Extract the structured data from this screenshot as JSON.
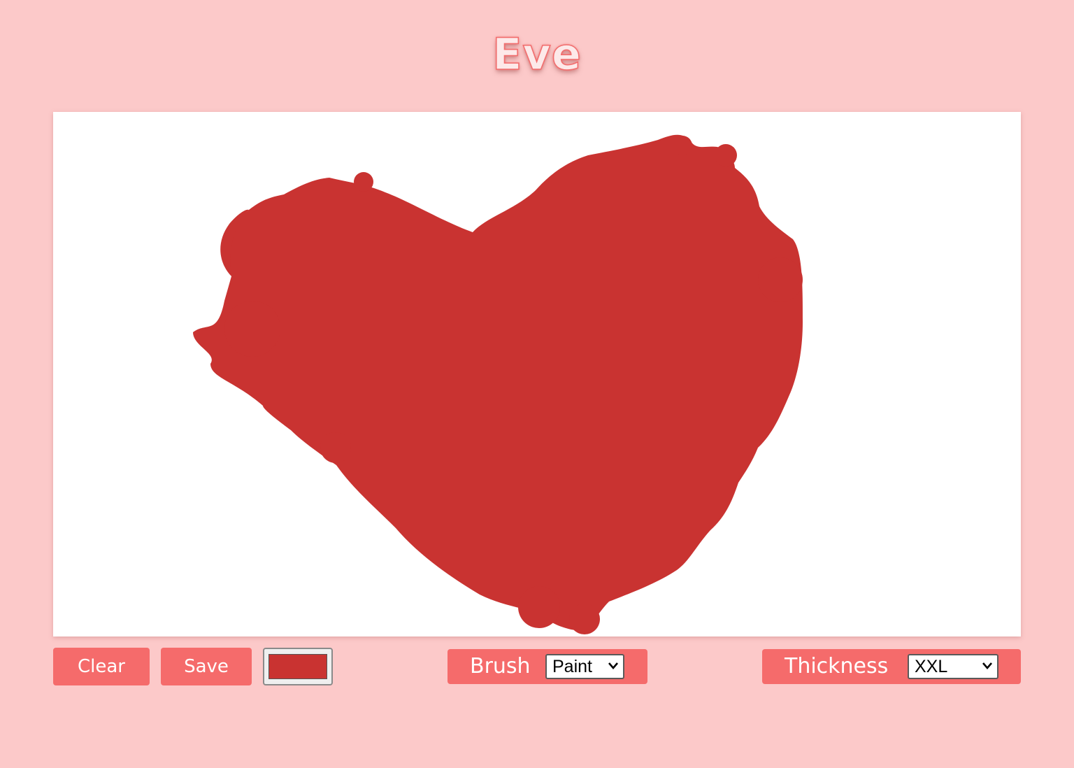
{
  "app": {
    "title": "Eve"
  },
  "canvas": {
    "background": "#ffffff",
    "drawing": "heart",
    "paint_color": "#c93331"
  },
  "toolbar": {
    "clear_label": "Clear",
    "save_label": "Save",
    "color_value": "#c93331",
    "brush": {
      "label": "Brush",
      "selected": "Paint"
    },
    "thickness": {
      "label": "Thickness",
      "selected": "XXL"
    }
  },
  "colors": {
    "page_background": "#fcc9c9",
    "accent": "#f56b6b",
    "button_text": "#ffffff"
  }
}
